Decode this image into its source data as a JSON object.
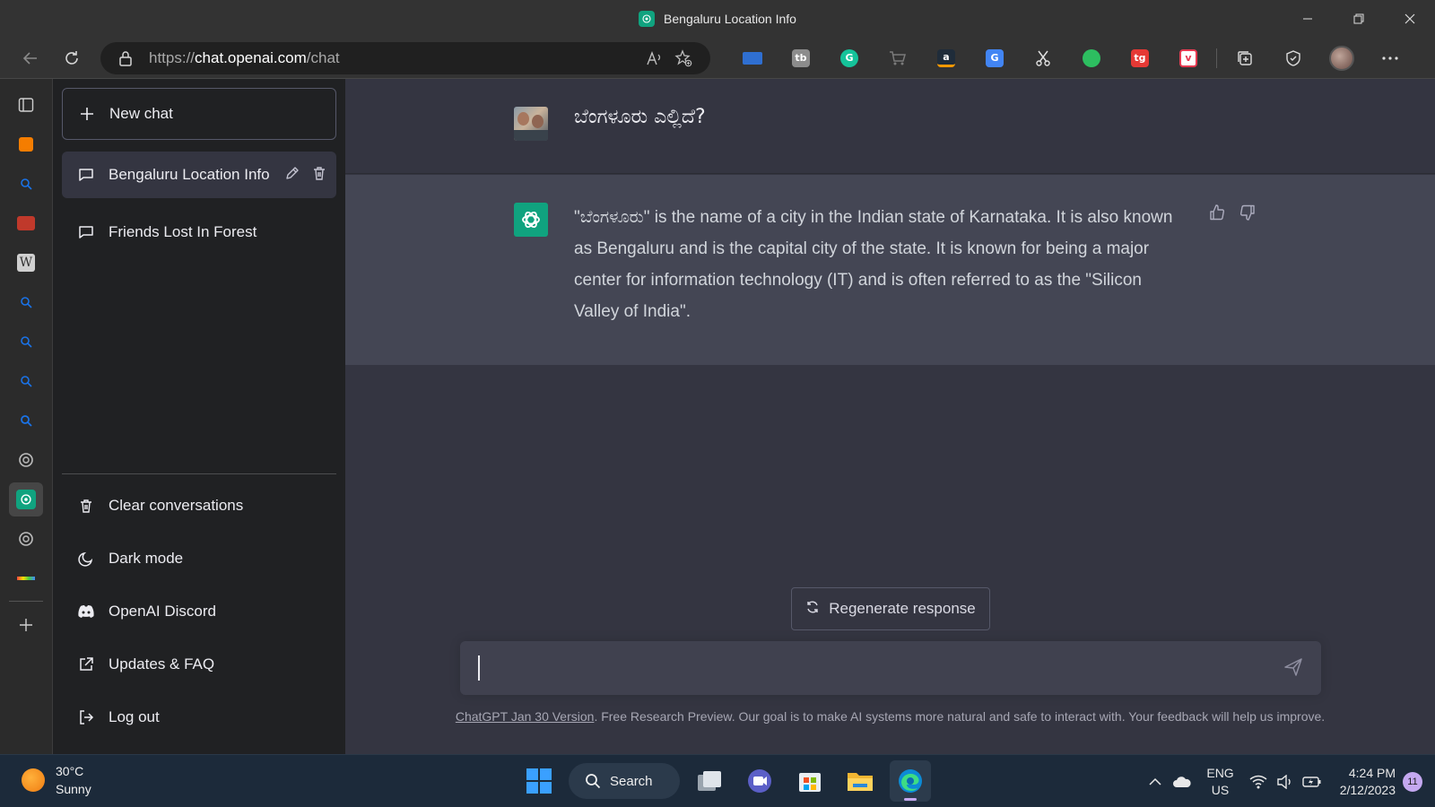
{
  "window": {
    "title": "Bengaluru Location Info"
  },
  "browser": {
    "url_prefix": "https://",
    "url_host": "chat.openai.com",
    "url_path": "/chat"
  },
  "chat_nav": {
    "new_chat_label": "New chat",
    "conversations": [
      {
        "label": "Bengaluru Location Info",
        "active": true
      },
      {
        "label": "Friends Lost In Forest",
        "active": false
      }
    ],
    "links": {
      "clear": "Clear conversations",
      "dark_mode": "Dark mode",
      "discord": "OpenAI Discord",
      "faq": "Updates & FAQ",
      "logout": "Log out"
    }
  },
  "conversation": {
    "user_message": "ಬೆಂಗಳೂರು ಎಲ್ಲಿದೆ?",
    "assistant_message": "\"ಬೆಂಗಳೂರು\" is the name of a city in the Indian state of Karnataka. It is also known as Bengaluru and is the capital city of the state. It is known for being a major center for information technology (IT) and is often referred to as the \"Silicon Valley of India\"."
  },
  "composer": {
    "regenerate_label": "Regenerate response",
    "input_value": "",
    "footer_version_link": "ChatGPT Jan 30 Version",
    "footer_text": ". Free Research Preview. Our goal is to make AI systems more natural and safe to interact with. Your feedback will help us improve."
  },
  "taskbar": {
    "weather_temp": "30°C",
    "weather_desc": "Sunny",
    "search_label": "Search",
    "lang_top": "ENG",
    "lang_bottom": "US",
    "time": "4:24 PM",
    "date": "2/12/2023",
    "notification_count": "11"
  },
  "colors": {
    "brand_green": "#10a37f",
    "sidebar_bg": "#202123",
    "main_bg": "#343541",
    "assistant_bg": "#444654"
  }
}
